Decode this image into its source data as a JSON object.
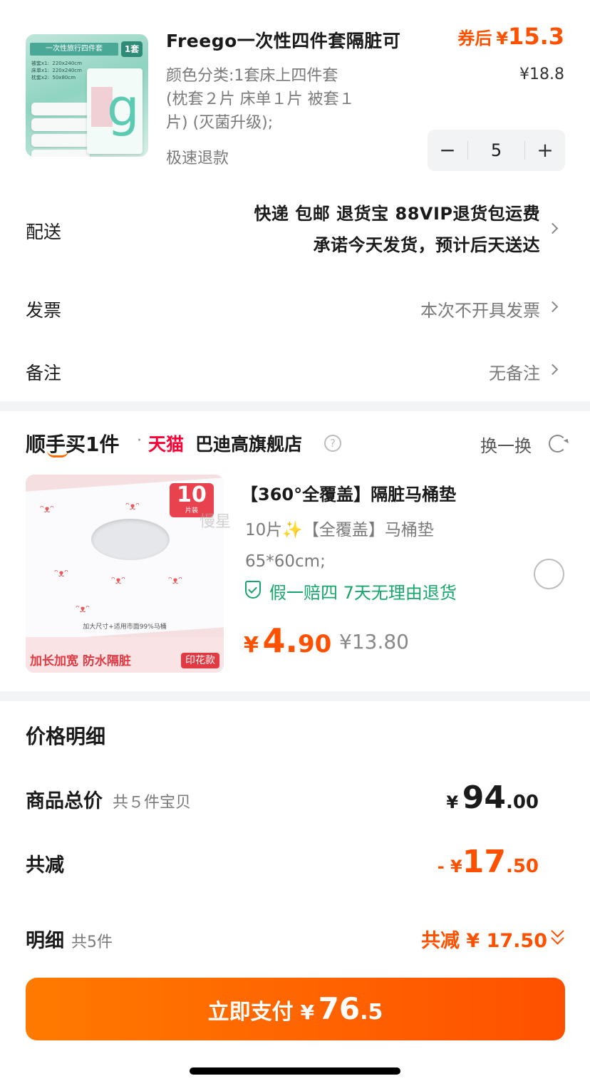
{
  "product": {
    "title": "Freego一次性四件套隔脏可",
    "coupon_label": "券后",
    "currency": "¥",
    "coupon_price": "15.3",
    "original_price": "¥18.8",
    "sku_line1": "颜色分类:1套床上四件套",
    "sku_line2": "(枕套２片 床单１片 被套１",
    "sku_line3": "片) (灭菌升级);",
    "refund_tag": "极速退款",
    "quantity": "5",
    "thumb_tag": "一次性旅行四件套",
    "thumb_badge": "1套",
    "thumb_specs": "被套x1:  220x240cm\n床单x1:  220x240cm\n枕套x2:  50x80cm"
  },
  "rows": {
    "delivery_label": "配送",
    "delivery_line1": "快递 包邮 退货宝 88VIP退货包运费",
    "delivery_line2": "承诺今天发货，预计后天送达",
    "invoice_label": "发票",
    "invoice_value": "本次不开具发票",
    "note_label": "备注",
    "note_value": "无备注"
  },
  "addon": {
    "section_title": "顺手买1件",
    "dot": "·",
    "tmall": "天猫",
    "store_name": "巴迪高旗舰店",
    "help": "?",
    "swap_label": "换一换",
    "title": "【360°全覆盖】隔脏马桶垫",
    "sku_line1": "10片✨【全覆盖】马桶垫",
    "sku_line2": "65*60cm;",
    "guarantee": "假一赔四  7天无理由退货",
    "price_symbol": "¥",
    "price_int": "4.",
    "price_dec": "90",
    "original_price": "¥13.80",
    "watermark": "慢星",
    "thumb_count": "10",
    "thumb_count_sub": "片装",
    "thumb_tiny": "加大尺寸+适用市面99%马桶",
    "thumb_banner": "加长加宽 防水隔脏",
    "thumb_print_tag": "印花款"
  },
  "price_detail": {
    "title": "价格明细",
    "total_label": "商品总价",
    "total_sub": "共５件宝贝",
    "total_symbol": "¥",
    "total_int": "94",
    "total_dec": ".00",
    "discount_label": "共减",
    "discount_prefix": "- ¥",
    "discount_int": "17",
    "discount_dec": ".50",
    "detail_label": "明细",
    "detail_sub": "共5件",
    "detail_value": "共减 ¥ 17.50"
  },
  "pay": {
    "label": "立即支付",
    "symbol": "¥",
    "int": "76",
    "dec": ".5"
  },
  "colors": {
    "accent": "#ff5000",
    "green": "#16a66c",
    "tmall_red": "#ff0036"
  }
}
